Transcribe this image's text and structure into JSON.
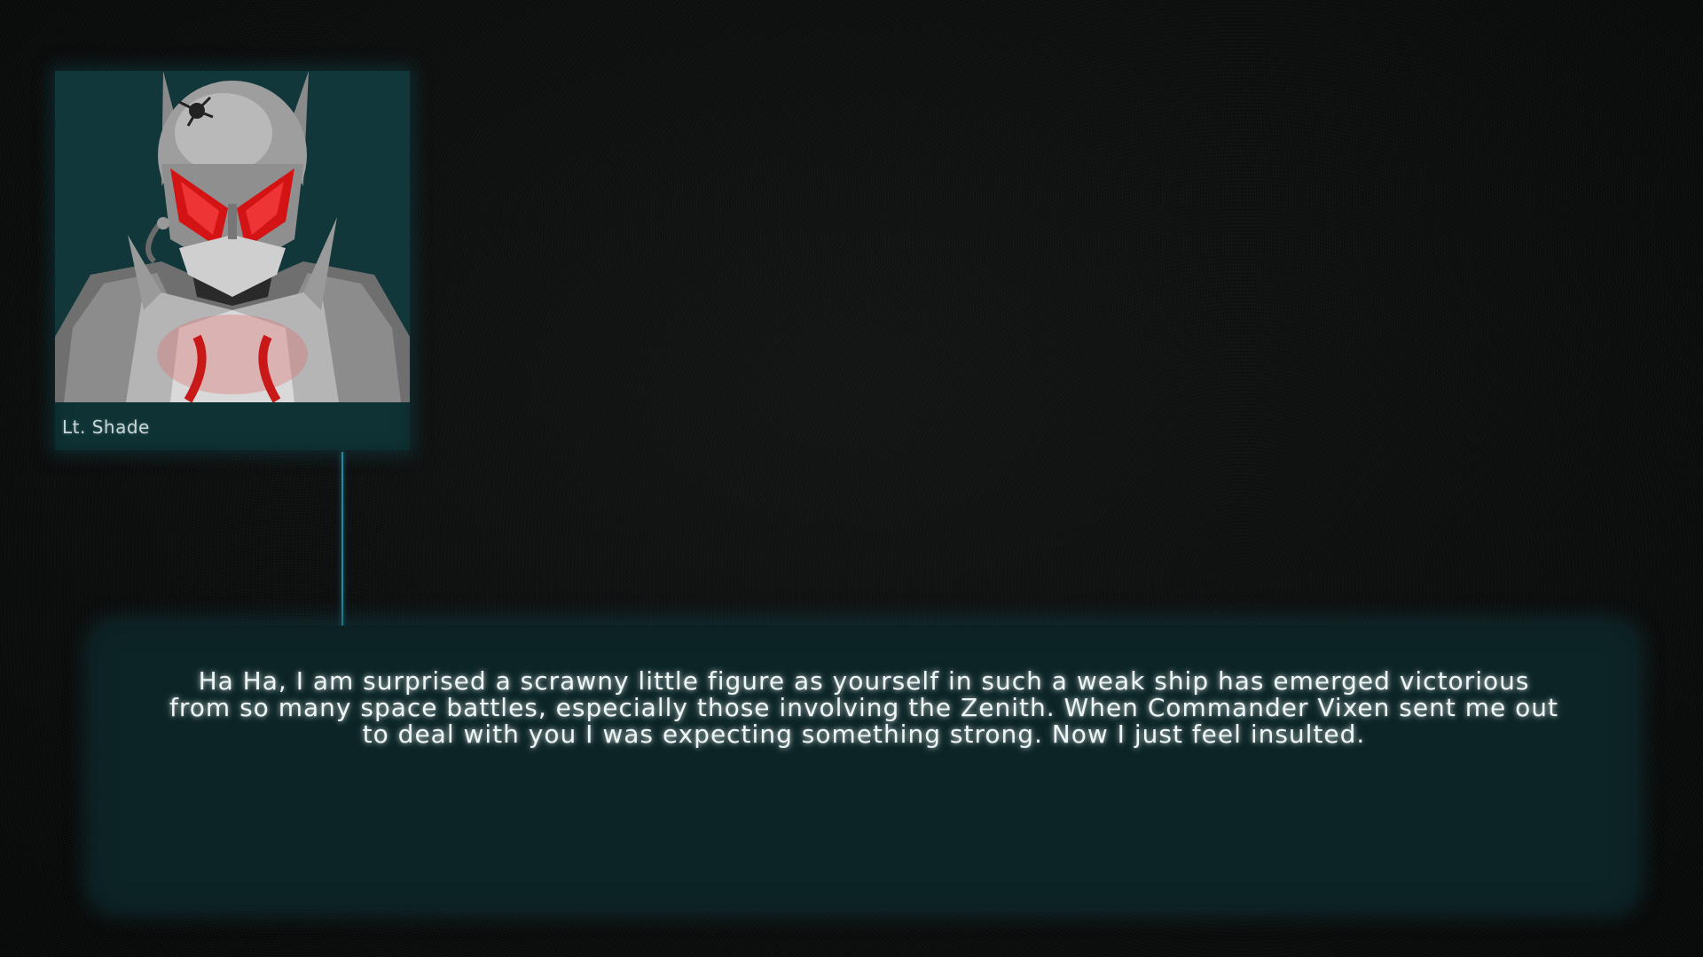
{
  "speaker": {
    "name": "Lt. Shade",
    "portrait_icon": "armored-helmet-portrait-icon"
  },
  "dialogue": {
    "text": "Ha Ha, I am surprised a scrawny little figure as yourself in such a weak ship has emerged victorious from so many space battles, especially those involving the Zenith. When Commander Vixen sent me out to deal with you I was expecting something strong. Now I just feel insulted."
  },
  "colors": {
    "background": "#0b0c0c",
    "panel": "#0f3335",
    "dialogue_panel": "#0d2426",
    "connector": "#1c8aa0",
    "accent_red": "#d01818"
  }
}
